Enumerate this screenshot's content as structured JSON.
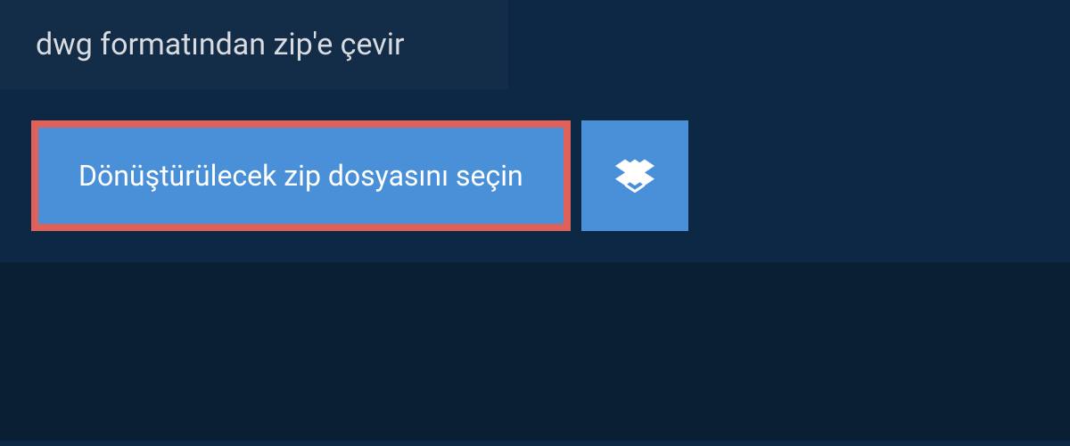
{
  "header": {
    "title": "dwg formatından zip'e çevir"
  },
  "buttons": {
    "select_file_label": "Dönüştürülecek zip dosyasını seçin"
  },
  "colors": {
    "background_dark": "#0d2844",
    "background_darker": "#0a1f33",
    "header_background": "#132c47",
    "button_blue": "#4a90d9",
    "highlight_red": "#e06159",
    "text_light": "#d8dce0",
    "text_white": "#ffffff"
  }
}
